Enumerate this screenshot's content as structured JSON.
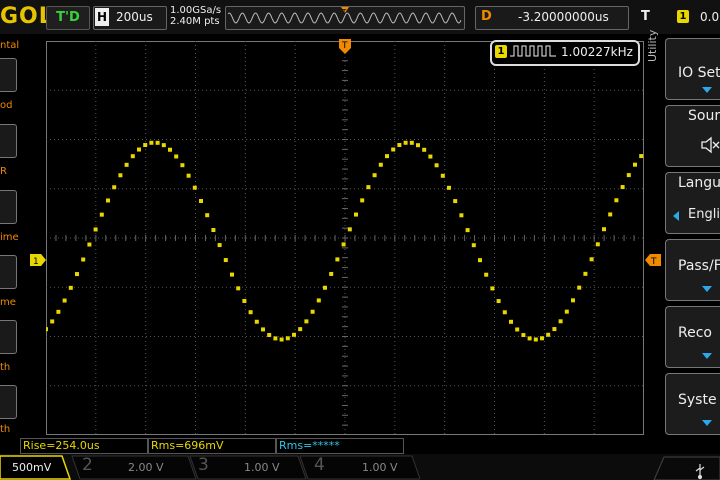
{
  "header": {
    "brand": "GOL",
    "run_status": "T'D",
    "timebase_label": "H",
    "timebase_value": "200us",
    "sample_rate": "1.00GSa/s",
    "memory_depth": "2.40M pts",
    "delay_label": "D",
    "delay_value": "-3.20000000us",
    "trigger_label": "T",
    "trigger_channel": "1",
    "trigger_value": "0.0"
  },
  "left_panel": {
    "labels": [
      "ntal",
      "od",
      "R",
      "ime",
      "me",
      "th",
      "th"
    ]
  },
  "frequency_counter": {
    "channel": "1",
    "value": "1.00227kHz"
  },
  "markers": {
    "channel1": "1",
    "trigger_level": "T"
  },
  "right_menu": {
    "title": "Utility",
    "items": [
      {
        "label": "IO Set"
      },
      {
        "label": "Sour"
      },
      {
        "label": "Langu",
        "value": "Engli"
      },
      {
        "label": "Pass/F"
      },
      {
        "label": "Reco"
      },
      {
        "label": "Syste"
      }
    ]
  },
  "measurements": [
    {
      "text": "Rise=254.0us",
      "color": "#e8d800"
    },
    {
      "text": "Rms=696mV",
      "color": "#e8d800"
    },
    {
      "text": "Rms=*****",
      "color": "#2ec6e8"
    }
  ],
  "channels": [
    {
      "num": "",
      "scale": "500mV",
      "color": "#e8d800"
    },
    {
      "num": "2",
      "scale": "2.00 V",
      "color": "#2ec6e8"
    },
    {
      "num": "3",
      "scale": "1.00 V",
      "color": "#d03cd0"
    },
    {
      "num": "4",
      "scale": "1.00 V",
      "color": "#3a6ae8"
    }
  ],
  "colors": {
    "ch1": "#e8d800",
    "ch2": "#2ec6e8",
    "trigger": "#f08a00",
    "menu_arrow": "#2aa8e8"
  },
  "waveform": {
    "channel": "1",
    "shape": "sine",
    "frequency_khz": 1.00227,
    "period_divs": 5.1
  }
}
